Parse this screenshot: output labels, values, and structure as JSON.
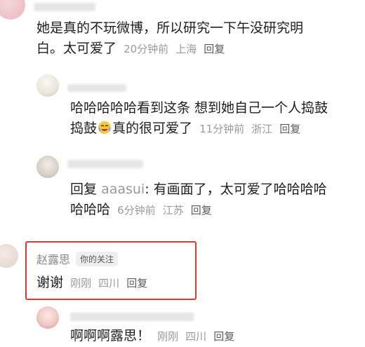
{
  "comments": [
    {
      "text_line1": "她是真的不玩微博，所以研究一下午没研究明",
      "text_line2": "白。太可爱了",
      "time": "20分钟前",
      "location": "上海",
      "reply_label": "回复"
    },
    {
      "text_line1": "哈哈哈哈哈看到这条 想到她自己一个人捣鼓",
      "text_line2a": "捣鼓",
      "emoji": "crying-laughing-face-icon",
      "text_line2b": "真的很可爱了",
      "time": "11分钟前",
      "location": "浙江",
      "reply_label": "回复"
    },
    {
      "prefix": "回复",
      "mention": "aaasui",
      "text_line1": ": 有画面了，太可爱了哈哈哈哈",
      "text_line2": "哈哈哈",
      "time": "6分钟前",
      "location": "江苏",
      "reply_label": "回复"
    },
    {
      "username": "赵露思",
      "badge": "你的关注",
      "text": "谢谢",
      "time": "刚刚",
      "location": "四川",
      "reply_label": "回复"
    },
    {
      "text": "啊啊啊露思！",
      "time": "刚刚",
      "location": "四川",
      "reply_label": "回复"
    }
  ],
  "colors": {
    "highlight_border": "#e8322d",
    "mention": "#9a9a9a"
  }
}
